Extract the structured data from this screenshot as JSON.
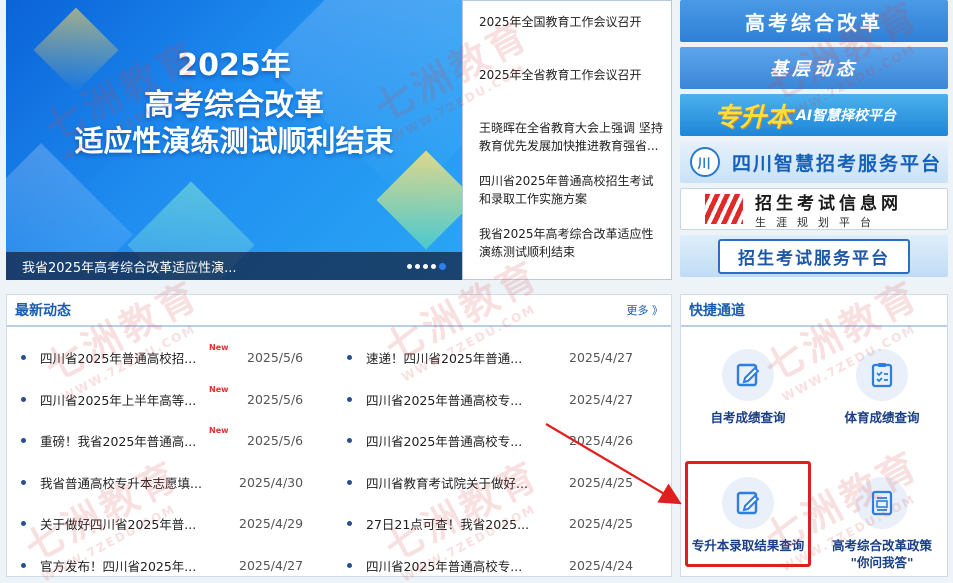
{
  "banner": {
    "headline_line1": "2025年",
    "headline_line2": "高考综合改革",
    "headline_line3": "适应性演练测试顺利结束",
    "caption": "我省2025年高考综合改革适应性演...",
    "slide_count": 5,
    "active_slide": 5
  },
  "top_news": [
    "2025年全国教育工作会议召开",
    "2025年全省教育工作会议召开",
    "王晓晖在全省教育大会上强调 坚持教育优先发展加快推进教育强省...",
    "四川省2025年普通高校招生考试和录取工作实施方案",
    "我省2025年高考综合改革适应性演练测试顺利结束"
  ],
  "side_links": {
    "link1": "高考综合改革",
    "link2": "基层动态",
    "link3_big": "专升本",
    "link3_small": "AI智慧择校平台",
    "link4_emblem": "川",
    "link4": "四川智慧招考服务平台",
    "link5_main": "招生考试信息网",
    "link5_sub": "生涯规划平台",
    "link6": "招生考试服务平台"
  },
  "latest": {
    "title": "最新动态",
    "more": "更多 》",
    "new_badge": "New",
    "left_items": [
      {
        "title": "四川省2025年普通高校招...",
        "date": "2025/5/6",
        "is_new": true
      },
      {
        "title": "四川省2025年上半年高等...",
        "date": "2025/5/6",
        "is_new": true
      },
      {
        "title": "重磅！我省2025年普通高...",
        "date": "2025/5/6",
        "is_new": true
      },
      {
        "title": "我省普通高校专升本志愿填...",
        "date": "2025/4/30",
        "is_new": false
      },
      {
        "title": "关于做好四川省2025年普...",
        "date": "2025/4/29",
        "is_new": false
      },
      {
        "title": "官方发布！四川省2025年...",
        "date": "2025/4/27",
        "is_new": false
      }
    ],
    "right_items": [
      {
        "title": "速递！四川省2025年普通...",
        "date": "2025/4/27"
      },
      {
        "title": "四川省2025年普通高校专...",
        "date": "2025/4/27"
      },
      {
        "title": "四川省2025年普通高校专...",
        "date": "2025/4/26"
      },
      {
        "title": "四川省教育考试院关于做好...",
        "date": "2025/4/25"
      },
      {
        "title": "27日21点可查！我省2025...",
        "date": "2025/4/25"
      },
      {
        "title": "四川省2025年普通高校专...",
        "date": "2025/4/24"
      }
    ]
  },
  "quick": {
    "title": "快捷通道",
    "items": [
      {
        "label": "自考成绩查询",
        "icon": "edit-icon"
      },
      {
        "label": "体育成绩查询",
        "icon": "clipboard-icon"
      },
      {
        "label": "专升本录取结果查询",
        "icon": "edit-icon"
      },
      {
        "label_line1": "高考综合改革政策",
        "label_line2": "\"你问我答\"",
        "icon": "document-icon"
      }
    ]
  },
  "watermark": {
    "main": "七洲教育",
    "sub": "WWW.7ZEDU.COM"
  },
  "colors": {
    "primary": "#1a5cb0",
    "highlight": "#e01e1e",
    "new_badge": "#e23030"
  }
}
